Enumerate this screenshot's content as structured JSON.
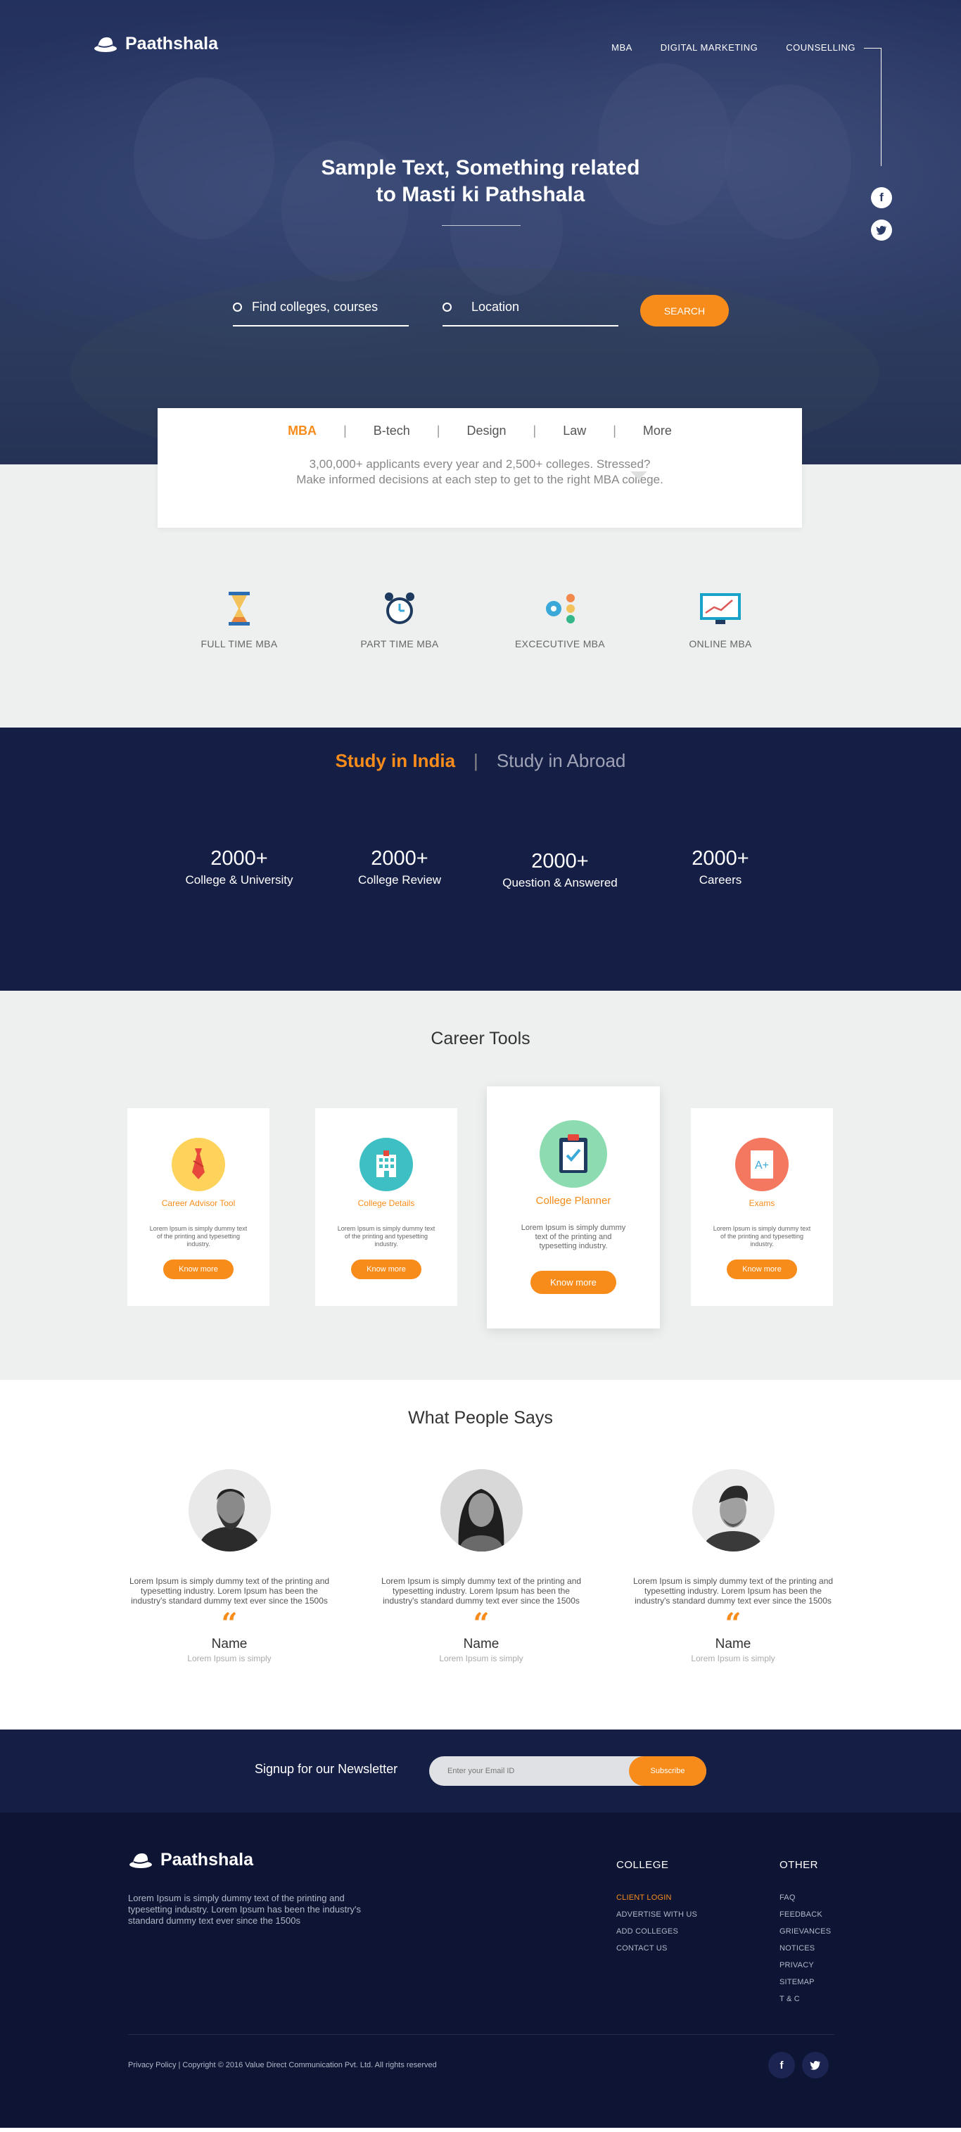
{
  "brand": {
    "name": "Paathshala"
  },
  "nav": {
    "items": [
      "MBA",
      "DIGITAL MARKETING",
      "COUNSELLING"
    ]
  },
  "hero": {
    "title_line1": "Sample Text, Something related",
    "title_line2_prefix": "to ",
    "title_line2_bold": "Masti ki Pathshala",
    "search_placeholder": "Find colleges, courses",
    "location_placeholder": "Location",
    "search_button": "SEARCH",
    "social": [
      "facebook-icon",
      "twitter-icon"
    ]
  },
  "categories": {
    "tabs": [
      "MBA",
      "B-tech",
      "Design",
      "Law",
      "More"
    ],
    "active_tab": "MBA",
    "desc_line1": "3,00,000+ applicants every year and 2,500+ colleges. Stressed?",
    "desc_line2": "Make informed decisions at each step to get to the right MBA college."
  },
  "programs": [
    {
      "label": "FULL TIME MBA",
      "icon": "hourglass-icon"
    },
    {
      "label": "PART TIME MBA",
      "icon": "alarm-clock-icon"
    },
    {
      "label": "EXCECUTIVE MBA",
      "icon": "gears-icon"
    },
    {
      "label": "ONLINE MBA",
      "icon": "monitor-chart-icon"
    }
  ],
  "study": {
    "india": "Study in India",
    "abroad": "Study in Abroad",
    "stats": [
      {
        "num": "2000+",
        "cap": "College & University"
      },
      {
        "num": "2000+",
        "cap": "College Review"
      },
      {
        "num": "2000+",
        "cap": "Question & Answered"
      },
      {
        "num": "2000+",
        "cap": "Careers"
      }
    ]
  },
  "tools": {
    "title": "Career Tools",
    "items": [
      {
        "title": "Career Advisor Tool",
        "desc": "Lorem Ipsum is simply dummy text of the printing and typesetting industry.",
        "btn": "Know more",
        "icon": "tie-icon",
        "color": "#fdd35c"
      },
      {
        "title": "College Details",
        "desc": "Lorem Ipsum is simply dummy text of the printing and typesetting industry.",
        "btn": "Know more",
        "icon": "building-icon",
        "color": "#3dbfc4"
      },
      {
        "title": "College Planner",
        "desc": "Lorem Ipsum is simply dummy text of the printing and typesetting industry.",
        "btn": "Know more",
        "icon": "clipboard-icon",
        "color": "#8ddcb1"
      },
      {
        "title": "Exams",
        "desc": "Lorem Ipsum is simply dummy text of the printing and typesetting industry.",
        "btn": "Know more",
        "icon": "exam-paper-icon",
        "color": "#f4775f"
      }
    ]
  },
  "testimonials": {
    "title": "What People Says",
    "items": [
      {
        "text": "Lorem Ipsum is simply dummy text of the printing and typesetting industry. Lorem Ipsum has been the industry's standard dummy text ever since the 1500s",
        "name": "Name",
        "sub": "Lorem Ipsum is simply"
      },
      {
        "text": "Lorem Ipsum is simply dummy text of the printing and typesetting industry. Lorem Ipsum has been the industry's standard dummy text ever since the 1500s",
        "name": "Name",
        "sub": "Lorem Ipsum is simply"
      },
      {
        "text": "Lorem Ipsum is simply dummy text of the printing and typesetting industry. Lorem Ipsum has been the industry's standard dummy text ever since the 1500s",
        "name": "Name",
        "sub": "Lorem Ipsum is simply"
      }
    ]
  },
  "newsletter": {
    "label": "Signup for our Newsletter",
    "placeholder": "Enter your Email ID",
    "button": "Subscribe"
  },
  "footer": {
    "about": "Lorem Ipsum is simply dummy text of the printing and typesetting industry. Lorem Ipsum has been the industry's standard dummy text ever since the 1500s",
    "college_title": "COLLEGE",
    "college_links": [
      "CLIENT LOGIN",
      "ADVERTISE WITH US",
      "ADD COLLEGES",
      "CONTACT US"
    ],
    "other_title": "OTHER",
    "other_links": [
      "FAQ",
      "FEEDBACK",
      "GRIEVANCES",
      "NOTICES",
      "PRIVACY",
      "SITEMAP",
      "T & C"
    ],
    "copyright": "Privacy Policy | Copyright © 2016 Value Direct Communication Pvt. Ltd. All rights reserved"
  }
}
